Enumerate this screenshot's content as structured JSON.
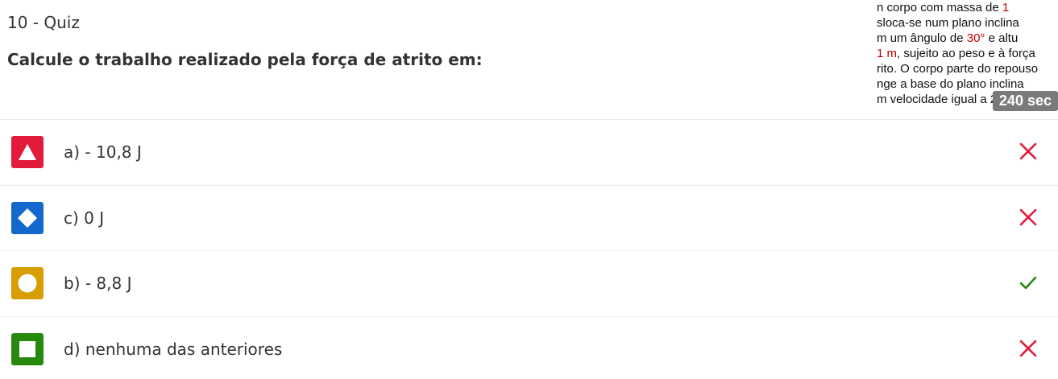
{
  "header": {
    "quiz_label": "10 - Quiz",
    "question": "Calcule o trabalho realizado pela força de atrito em:"
  },
  "snippet": {
    "lines": [
      {
        "text": "n  corpo  com  massa  de  ",
        "red": "1"
      },
      {
        "text": "sloca-se  num  plano  inclina",
        "red": ""
      },
      {
        "text": "m  um  ângulo  de  ",
        "red": "30°",
        "after": "  e  altu"
      },
      {
        "red_lead": "1 m",
        "text": ", sujeito ao peso e à força"
      },
      {
        "text": "rito. O corpo parte do repouso",
        "red": ""
      },
      {
        "text": "nge  a  base  do  plano  inclina",
        "red": ""
      },
      {
        "text": "m velocidade igual a 2 m/s.",
        "red": ""
      }
    ],
    "timer": "240 sec"
  },
  "answers": [
    {
      "label": "a) - 10,8 J",
      "shape": "triangle-icon",
      "color": "#e21b3c",
      "correct": false
    },
    {
      "label": "c) 0 J",
      "shape": "diamond-icon",
      "color": "#1368ce",
      "correct": false
    },
    {
      "label": "b) - 8,8 J",
      "shape": "circle-icon",
      "color": "#d89e00",
      "correct": true
    },
    {
      "label": "d) nenhuma das anteriores",
      "shape": "square-icon",
      "color": "#26890c",
      "correct": false
    }
  ],
  "colors": {
    "wrong": "#e21b3c",
    "correct": "#26890c"
  }
}
